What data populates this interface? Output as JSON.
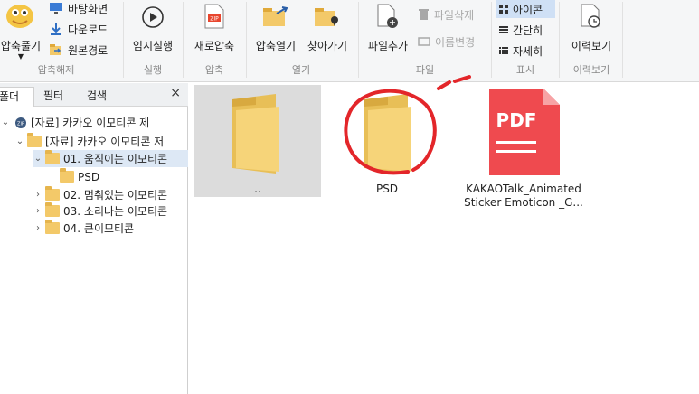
{
  "ribbon": {
    "extract": {
      "small_items": [
        {
          "label": "바탕화면",
          "icon": "monitor-icon"
        },
        {
          "label": "다운로드",
          "icon": "download-icon"
        },
        {
          "label": "원본경로",
          "icon": "folder-path-icon"
        }
      ],
      "big_label": "압축풀기",
      "group_label": "압축해제"
    },
    "run": {
      "label": "임시실행",
      "group_label": "실행"
    },
    "compress": {
      "label": "새로압축",
      "group_label": "압축"
    },
    "open": {
      "open_label": "압축열기",
      "find_label": "찾아가기",
      "group_label": "열기"
    },
    "file": {
      "add_label": "파일추가",
      "delete_label": "파일삭제",
      "rename_label": "이름변경",
      "group_label": "파일"
    },
    "view": {
      "icon_label": "아이콘",
      "brief_label": "간단히",
      "detail_label": "자세히",
      "group_label": "표시"
    },
    "history": {
      "label": "이력보기",
      "group_label": "이력보기"
    }
  },
  "sidebar": {
    "tabs": [
      "폴더",
      "필터",
      "검색"
    ],
    "close": "×",
    "tree": [
      {
        "label": "[자료] 카카오 이모티콘 제",
        "level": 0
      },
      {
        "label": "[자료] 카카오 이모티콘 저",
        "level": 1
      },
      {
        "label": "01. 움직이는 이모티콘",
        "level": 2
      },
      {
        "label": "PSD",
        "level": 3
      },
      {
        "label": "02. 멈춰있는 이모티콘",
        "level": 2
      },
      {
        "label": "03. 소리나는 이모티콘",
        "level": 2
      },
      {
        "label": "04. 큰이모티콘",
        "level": 2
      }
    ]
  },
  "content": {
    "items": [
      {
        "caption": "..",
        "type": "folder"
      },
      {
        "caption": "PSD",
        "type": "folder"
      },
      {
        "caption_line1": "KAKAOTalk_Animated",
        "caption_line2": "Sticker Emoticon _G...",
        "type": "pdf",
        "badge": "PDF"
      }
    ]
  },
  "colors": {
    "accent": "#e33a3a",
    "folder": "#f3c969",
    "pdf": "#ef4a4f",
    "annotation": "#e3262a"
  }
}
